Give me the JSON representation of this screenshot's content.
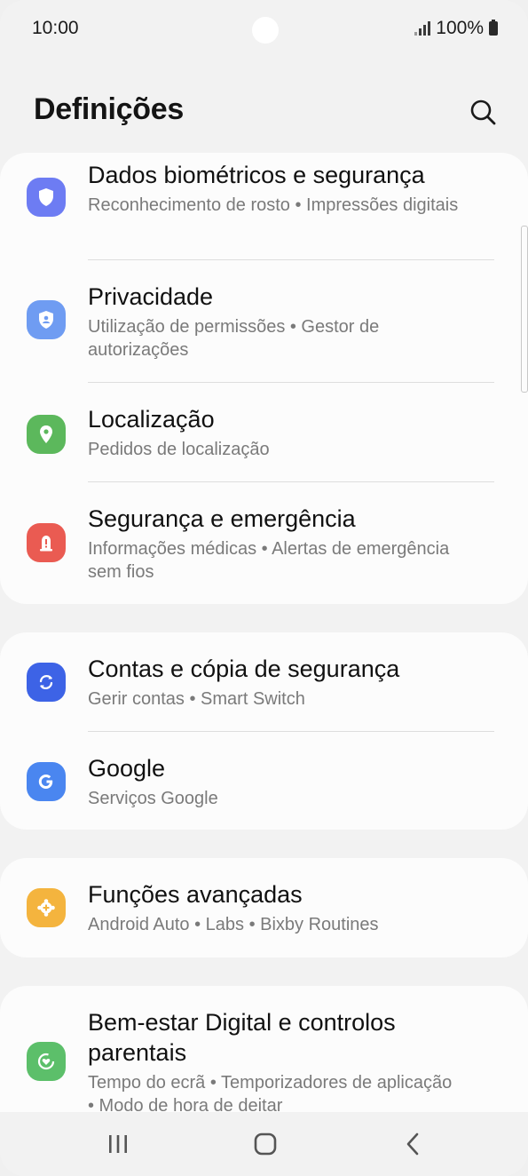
{
  "status_bar": {
    "time": "10:00",
    "battery": "100%"
  },
  "header": {
    "title": "Definições"
  },
  "sections": [
    {
      "items": [
        {
          "title": "Dados biométricos e segurança",
          "subtitle": "Reconhecimento de rosto  •  Impressões digitais",
          "icon": "shield-icon",
          "color": "#6d7cf3"
        },
        {
          "title": "Privacidade",
          "subtitle": "Utilização de permissões  •  Gestor de autorizações",
          "icon": "privacy-shield-icon",
          "color": "#6f9cf2"
        },
        {
          "title": "Localização",
          "subtitle": "Pedidos de localização",
          "icon": "location-pin-icon",
          "color": "#5cb85c"
        },
        {
          "title": "Segurança e emergência",
          "subtitle": "Informações médicas  •  Alertas de emergência sem fios",
          "icon": "emergency-alert-icon",
          "color": "#ea5b52"
        }
      ]
    },
    {
      "items": [
        {
          "title": "Contas e cópia de segurança",
          "subtitle": "Gerir contas  •  Smart Switch",
          "icon": "sync-icon",
          "color": "#3d63e6"
        },
        {
          "title": "Google",
          "subtitle": "Serviços Google",
          "icon": "google-g-icon",
          "color": "#4a86f0"
        }
      ]
    },
    {
      "items": [
        {
          "title": "Funções avançadas",
          "subtitle": "Android Auto  •  Labs  •  Bixby Routines",
          "icon": "advanced-gear-plus-icon",
          "color": "#f4b43e"
        }
      ]
    },
    {
      "items": [
        {
          "title": "Bem-estar Digital e controlos parentais",
          "subtitle": "Tempo do ecrã  •  Temporizadores de aplicação  •  Modo de hora de deitar",
          "icon": "wellbeing-heart-icon",
          "color": "#5cbf6a"
        }
      ]
    }
  ]
}
